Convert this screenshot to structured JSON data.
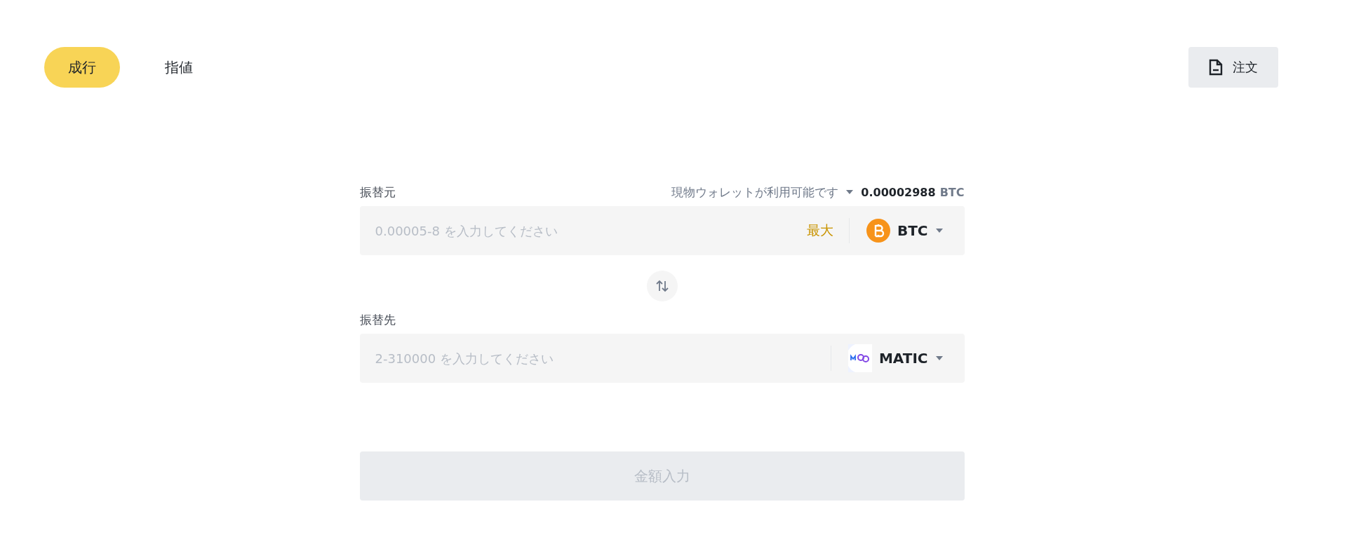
{
  "tabs": [
    {
      "label": "成行",
      "selected": true
    },
    {
      "label": "指値",
      "selected": false
    }
  ],
  "orders_button": {
    "label": "注文"
  },
  "from": {
    "label": "振替元",
    "wallet": "現物ウォレットが利用可能です",
    "balance": "0.00002988",
    "balance_unit": "BTC",
    "placeholder": "0.00005-8 を入力してください",
    "max": "最大",
    "coin": "BTC",
    "kind": "btc"
  },
  "to": {
    "label": "振替先",
    "placeholder": "2-310000 を入力してください",
    "coin": "MATIC",
    "kind": "matic"
  },
  "submit": {
    "label": "金額入力",
    "disabled": true
  }
}
